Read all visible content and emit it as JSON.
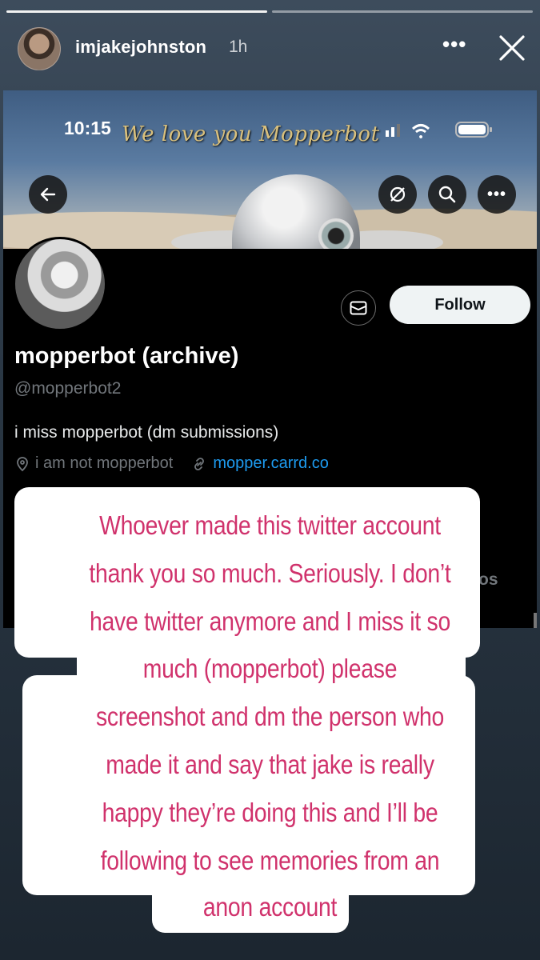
{
  "story": {
    "username": "imjakejohnston",
    "time_ago": "1h",
    "more_icon": "more-dots-icon",
    "close_icon": "close-icon",
    "progress": [
      1,
      0
    ]
  },
  "screenshot": {
    "status_time": "10:15",
    "banner_text": "We love you Mopperbot",
    "display_name": "mopperbot (archive)",
    "handle": "@mopperbot2",
    "bio": "i miss mopperbot (dm submissions)",
    "location": "i am not mopperbot",
    "website": "mopper.carrd.co",
    "follow_label": "Follow",
    "tab_fragment": "os",
    "colors": {
      "link": "#1d9bf0",
      "muted": "#71767b"
    }
  },
  "sticker": {
    "color": "#d0326c",
    "lines": [
      "Whoever made this twitter account",
      "thank you so much. Seriously. I don’t",
      "have twitter anymore and I miss it so",
      "much (mopperbot) please",
      "screenshot and dm the person who",
      "made it and say that jake is really",
      "happy they’re doing this and I’ll be",
      "following to see memories from an",
      "anon account"
    ]
  }
}
